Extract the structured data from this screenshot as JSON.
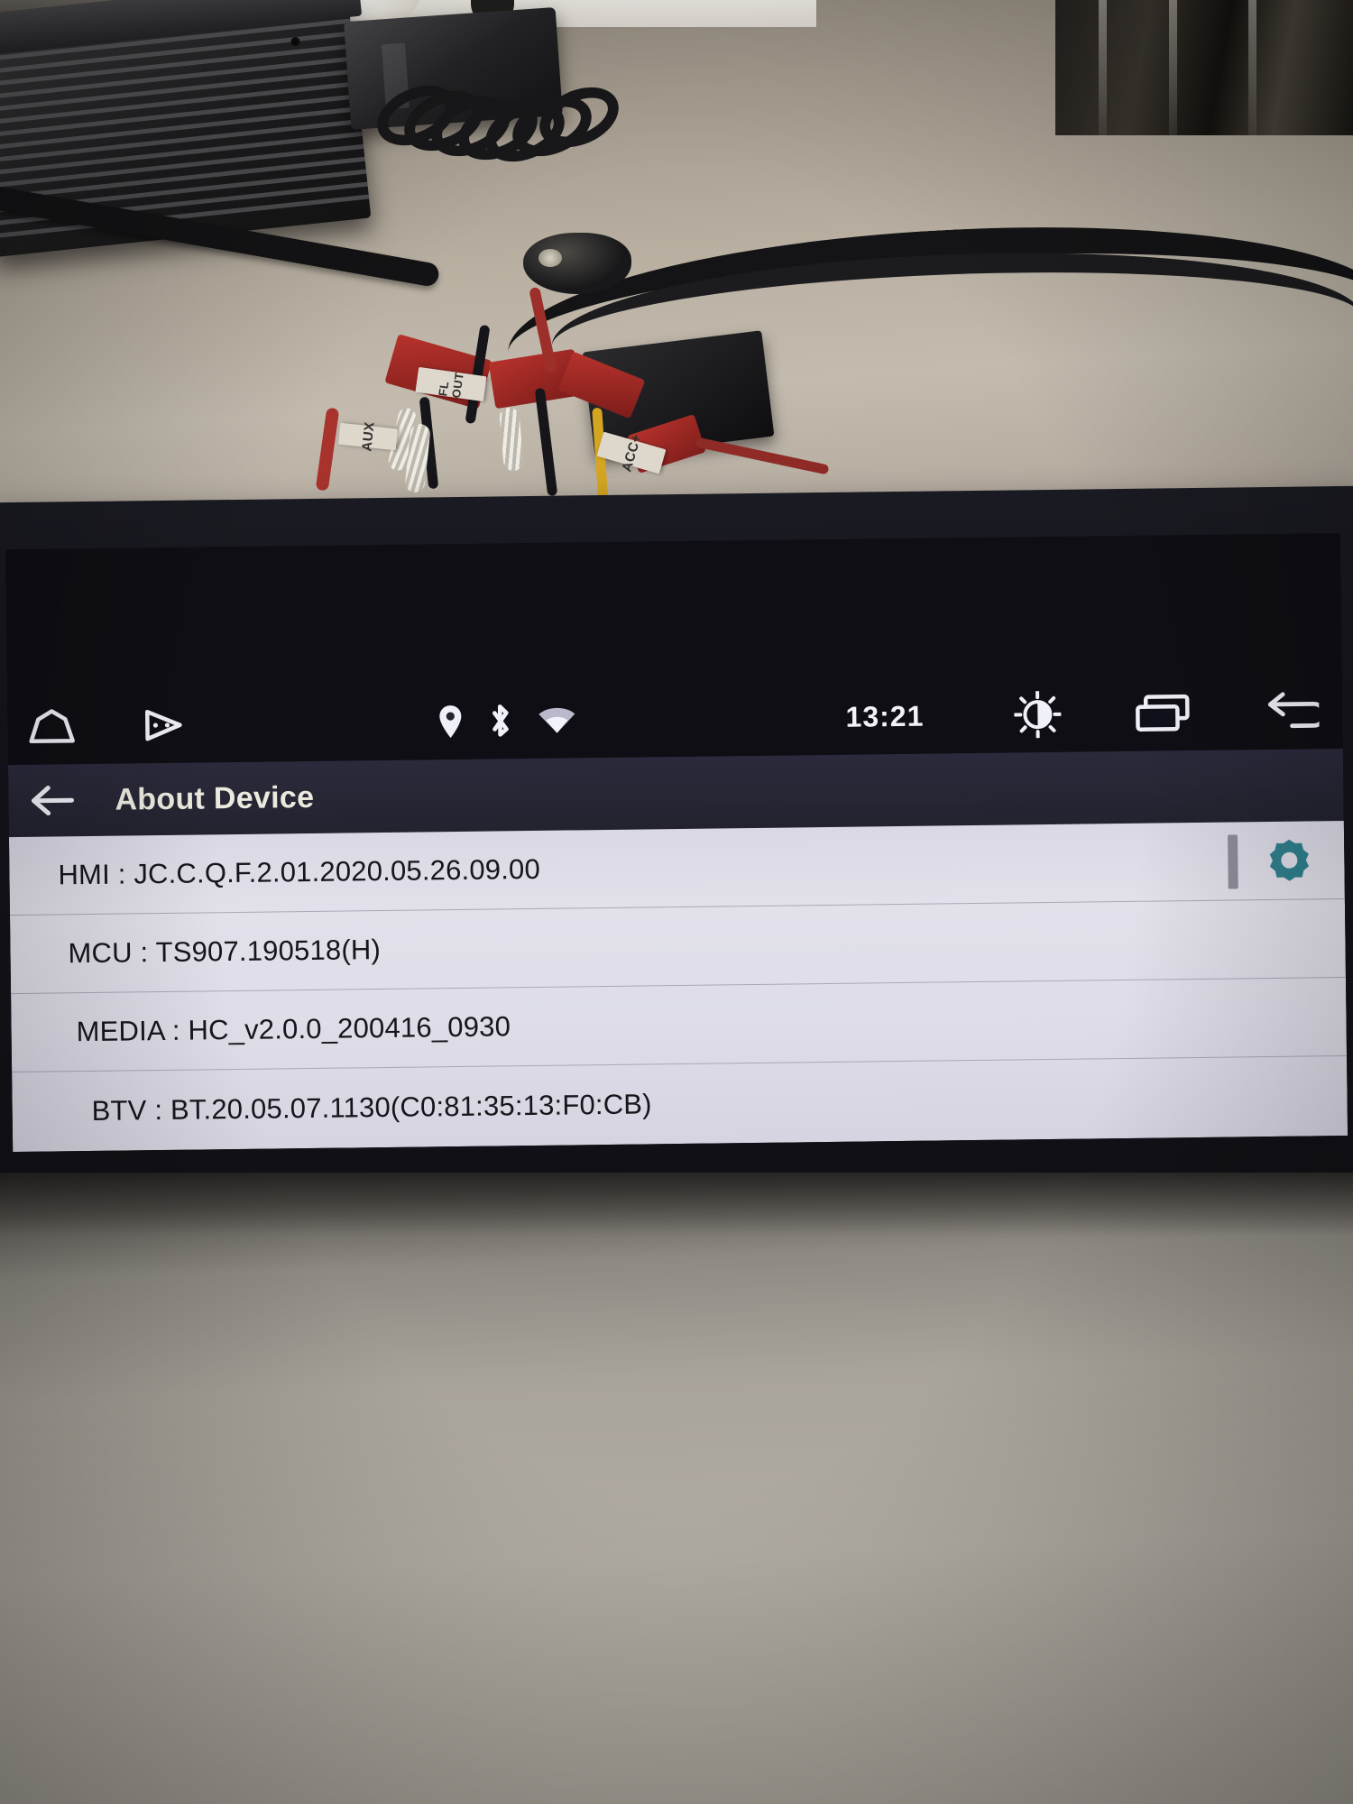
{
  "device": {
    "kind": "android-car-head-unit",
    "bezel_color": "#14141b"
  },
  "statusbar": {
    "clock": "13:21",
    "left_icons": [
      {
        "name": "home-icon",
        "label": "Home"
      },
      {
        "name": "navigation-icon",
        "label": "Navigation"
      }
    ],
    "center_icons": [
      {
        "name": "location-icon",
        "label": "Location"
      },
      {
        "name": "bluetooth-icon",
        "label": "Bluetooth"
      },
      {
        "name": "wifi-icon",
        "label": "Wi-Fi"
      }
    ],
    "right_icons": [
      {
        "name": "brightness-icon",
        "label": "Brightness"
      },
      {
        "name": "recents-icon",
        "label": "Recent apps"
      },
      {
        "name": "back-icon",
        "label": "Back"
      }
    ]
  },
  "titlebar": {
    "back_label": "Back",
    "title": "About Device"
  },
  "about": {
    "scrollbar_present": true,
    "settings_icon_label": "Settings",
    "settings_icon_color": "#2f7f8c",
    "rows": [
      {
        "label": "HMI",
        "value": "JC.C.Q.F.2.01.2020.05.26.09.00",
        "text": "HMI : JC.C.Q.F.2.01.2020.05.26.09.00"
      },
      {
        "label": "MCU",
        "value": "TS907.190518(H)",
        "text": "MCU : TS907.190518(H)"
      },
      {
        "label": "MEDIA",
        "value": "HC_v2.0.0_200416_0930",
        "text": "MEDIA : HC_v2.0.0_200416_0930"
      },
      {
        "label": "BTV",
        "value": "BT.20.05.07.1130(C0:81:35:13:F0:CB)",
        "text": "BTV : BT.20.05.07.1130(C0:81:35:13:F0:CB)"
      }
    ]
  },
  "scene": {
    "wire_tags": [
      {
        "name": "aux-wire-tag",
        "text": "AUX"
      },
      {
        "name": "fl-out-wire-tag",
        "text": "FL OUT"
      },
      {
        "name": "acc-wire-tag",
        "text": "ACC+"
      }
    ]
  }
}
